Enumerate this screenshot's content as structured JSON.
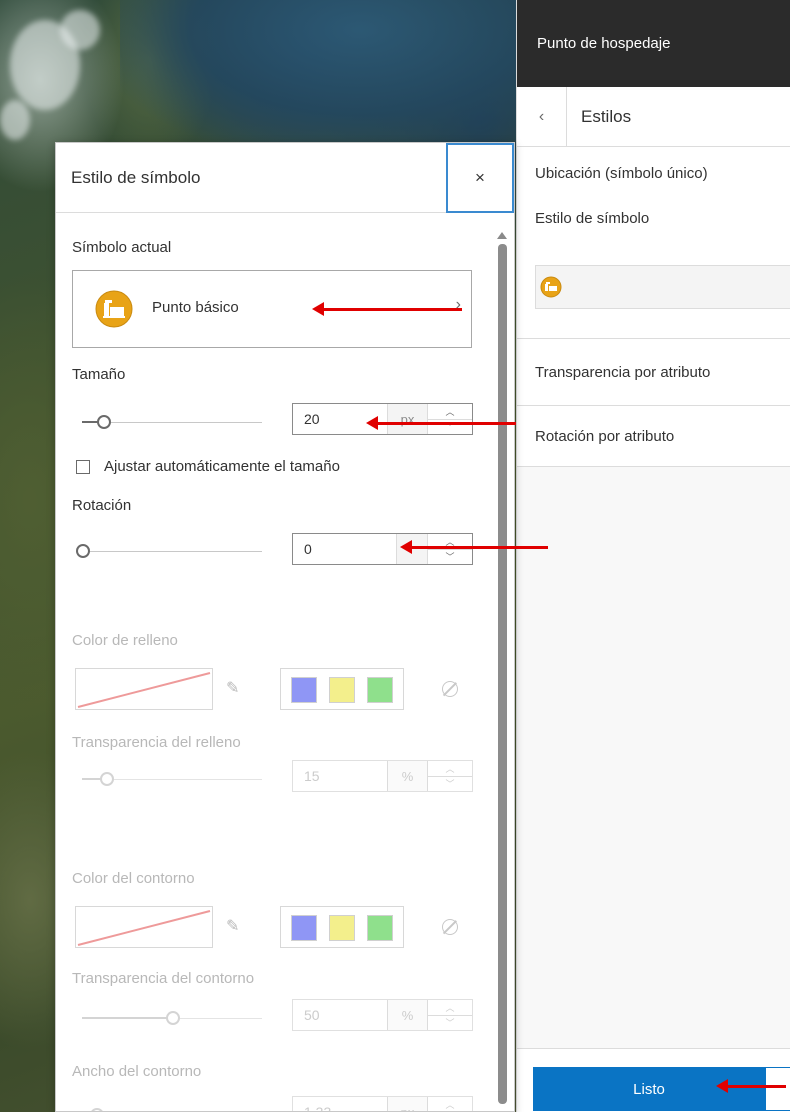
{
  "side_panel": {
    "header_title": "Punto de hospedaje",
    "sub_title": "Estilos",
    "location_heading": "Ubicación (símbolo único)",
    "symbol_style_label": "Estilo de símbolo",
    "rows": [
      "Transparencia por atributo",
      "Rotación por atributo"
    ],
    "done_button": "Listo"
  },
  "symbol_panel": {
    "title": "Estilo de símbolo",
    "close_icon": "×",
    "current_symbol_label": "Símbolo actual",
    "current_symbol_name": "Punto básico",
    "current_symbol_chevron": "›",
    "size": {
      "label": "Tamaño",
      "value": "20",
      "unit": "px",
      "slider_fraction": 0.12
    },
    "auto_size_label": "Ajustar automáticamente el tamaño",
    "rotation": {
      "label": "Rotación",
      "value": "0",
      "slider_fraction": 0.0
    },
    "fill_color_label": "Color de relleno",
    "fill_transparency": {
      "label": "Transparencia del relleno",
      "value": "15",
      "unit": "%",
      "slider_fraction": 0.15
    },
    "outline_color_label": "Color del contorno",
    "outline_transparency": {
      "label": "Transparencia del contorno",
      "value": "50",
      "unit": "%",
      "slider_fraction": 0.5
    },
    "outline_width": {
      "label": "Ancho del contorno",
      "value": "1.33",
      "unit": "px",
      "slider_fraction": 0.05
    },
    "palette_colors": [
      "#8f96f5",
      "#f3ef8c",
      "#8fe08c"
    ],
    "spin_up": "︿",
    "spin_down": "﹀"
  },
  "colors": {
    "accent": "#0a74c4",
    "symbol_orange": "#e8a317",
    "annotation_arrow": "#e00000"
  }
}
